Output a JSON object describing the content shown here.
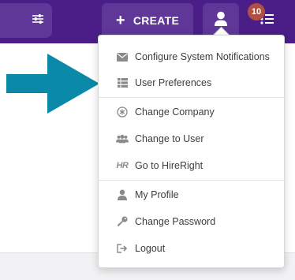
{
  "topbar": {
    "create_label": "CREATE",
    "notification_count": "10"
  },
  "user_menu": {
    "items": [
      {
        "label": "Configure System Notifications",
        "icon": "envelope-icon"
      },
      {
        "label": "User Preferences",
        "icon": "list-icon"
      },
      {
        "label": "Change Company",
        "icon": "asterisk-circle-icon"
      },
      {
        "label": "Change to User",
        "icon": "users-icon"
      },
      {
        "label": "Go to HireRight",
        "icon": "hireright-logo-icon",
        "logo_text": "HR"
      },
      {
        "label": "My Profile",
        "icon": "user-icon"
      },
      {
        "label": "Change Password",
        "icon": "key-icon"
      },
      {
        "label": "Logout",
        "icon": "sign-out-icon"
      }
    ]
  },
  "colors": {
    "topbar": "#4a1e86",
    "button": "#5e3798",
    "badge": "#b24f43",
    "arrow": "#0a8aa8",
    "icon_gray": "#8a8a8a"
  }
}
